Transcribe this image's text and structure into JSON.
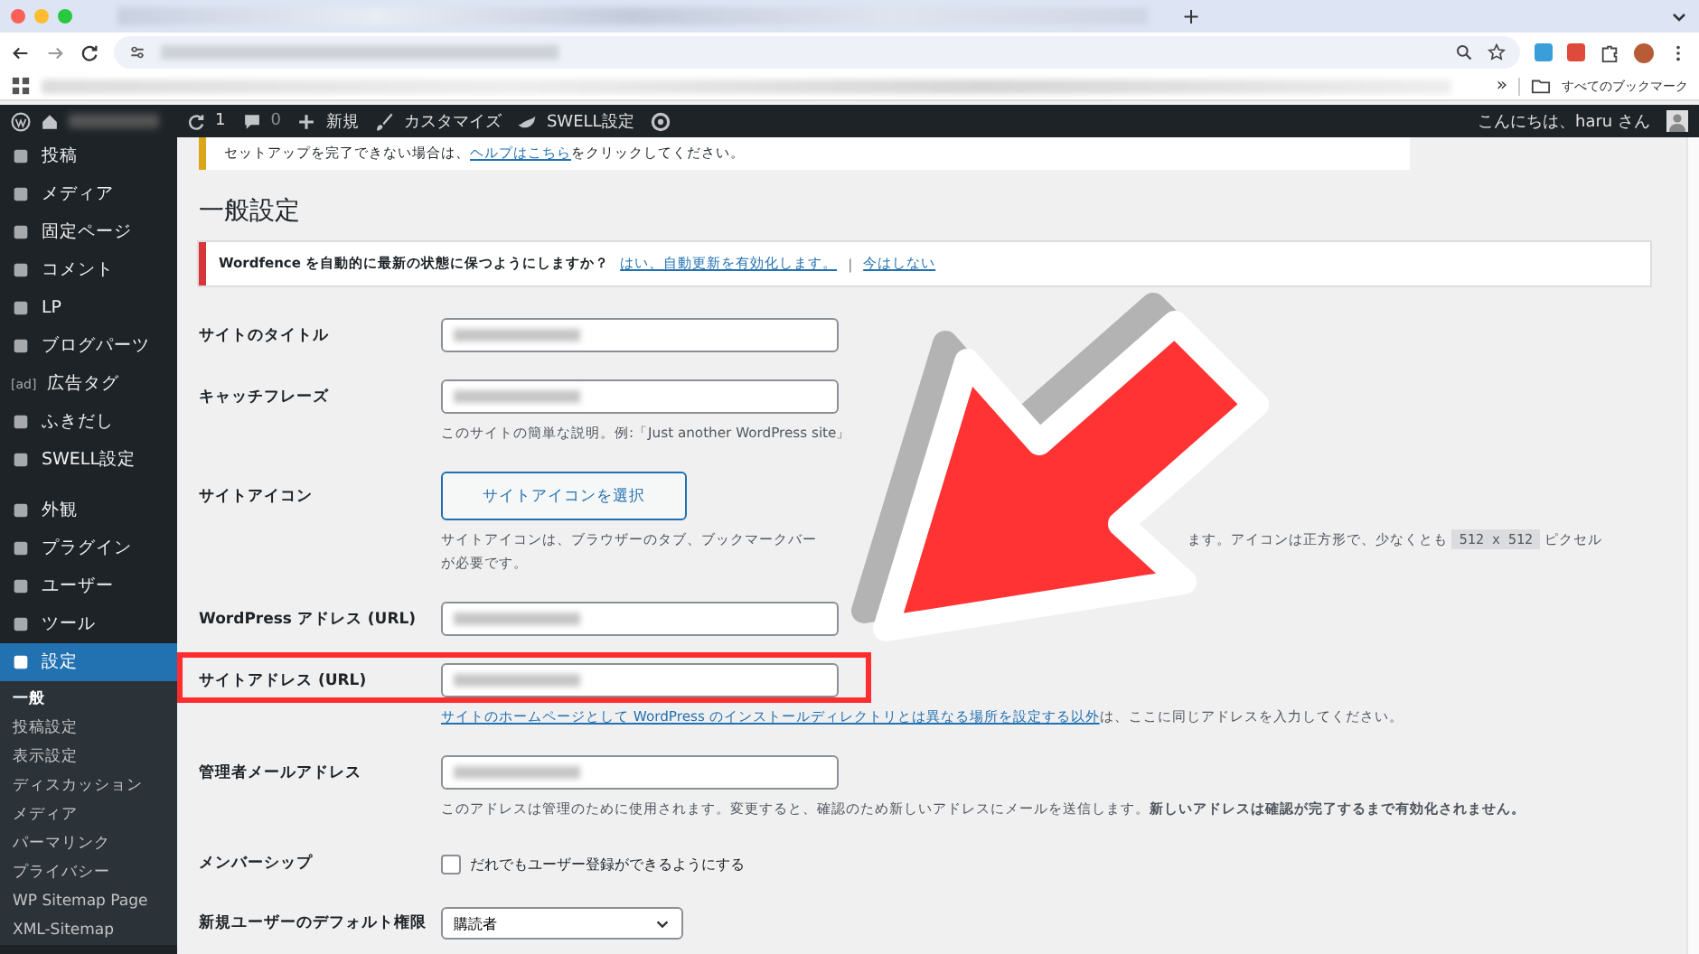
{
  "browser": {
    "new_tab": "+",
    "bookmarks_more": "»",
    "bookmarks_folder": "すべてのブックマーク"
  },
  "admin_bar": {
    "updates": "1",
    "comments": "0",
    "new": "新規",
    "customize": "カスタマイズ",
    "swell": "SWELL設定",
    "greeting": "こんにちは、haru さん"
  },
  "sidebar": {
    "items": [
      {
        "label": "投稿",
        "selected": false
      },
      {
        "label": "メディア",
        "selected": false
      },
      {
        "label": "固定ページ",
        "selected": false
      },
      {
        "label": "コメント",
        "selected": false
      },
      {
        "label": "LP",
        "selected": false
      },
      {
        "label": "ブログパーツ",
        "selected": false
      },
      {
        "label": "広告タグ",
        "selected": false,
        "icon_text": "[ad]"
      },
      {
        "label": "ふきだし",
        "selected": false
      },
      {
        "label": "SWELL設定",
        "selected": false
      },
      {
        "label": "外観",
        "selected": false
      },
      {
        "label": "プラグイン",
        "selected": false
      },
      {
        "label": "ユーザー",
        "selected": false
      },
      {
        "label": "ツール",
        "selected": false
      },
      {
        "label": "設定",
        "selected": true
      }
    ],
    "submenu": [
      {
        "label": "一般",
        "selected": true
      },
      {
        "label": "投稿設定",
        "selected": false
      },
      {
        "label": "表示設定",
        "selected": false
      },
      {
        "label": "ディスカッション",
        "selected": false
      },
      {
        "label": "メディア",
        "selected": false
      },
      {
        "label": "パーマリンク",
        "selected": false
      },
      {
        "label": "プライバシー",
        "selected": false
      },
      {
        "label": "WP Sitemap Page",
        "selected": false
      },
      {
        "label": "XML-Sitemap",
        "selected": false
      }
    ]
  },
  "notice": {
    "text_before": "セットアップを完了できない場合は、",
    "link": "ヘルプはこちら",
    "text_after": "をクリックしてください。"
  },
  "heading": "一般設定",
  "wordfence": {
    "text": "Wordfence を自動的に最新の状態に保つようにしますか？",
    "link_yes": "はい、自動更新を有効化します。",
    "separator": "|",
    "link_no": "今はしない"
  },
  "fields": [
    {
      "kind": "text",
      "label": "サイトのタイトル",
      "highlighted": false
    },
    {
      "kind": "text",
      "label": "キャッチフレーズ",
      "highlighted": false,
      "description": "このサイトの簡単な説明。例:「Just another WordPress site」"
    },
    {
      "kind": "button",
      "label": "サイトアイコン",
      "highlighted": false,
      "button": "サイトアイコンを選択",
      "description_start": "サイトアイコンは、ブラウザーのタブ、ブックマークバー",
      "description_end": "ます。アイコンは正方形で、少なくとも",
      "code": "512 x 512",
      "description_tail": "ピクセルが必要です。"
    },
    {
      "kind": "text",
      "label": "WordPress アドレス (URL)",
      "highlighted": false
    },
    {
      "kind": "text",
      "label": "サイトアドレス (URL)",
      "highlighted": true,
      "description_link": "サイトのホームページとして WordPress のインストールディレクトリとは異なる場所を設定する以外",
      "description": "は、ここに同じアドレスを入力してください。"
    },
    {
      "kind": "text",
      "label": "管理者メールアドレス",
      "highlighted": false,
      "description": "このアドレスは管理のために使用されます。変更すると、確認のため新しいアドレスにメールを送信します。**新しいアドレスは確認が完了するまで有効化されません。**"
    },
    {
      "kind": "checkbox",
      "label": "メンバーシップ",
      "highlighted": false,
      "checkbox_label": "だれでもユーザー登録ができるようにする",
      "checked": false
    },
    {
      "kind": "select",
      "label": "新規ユーザーのデフォルト権限",
      "highlighted": false,
      "value": "購読者"
    }
  ]
}
